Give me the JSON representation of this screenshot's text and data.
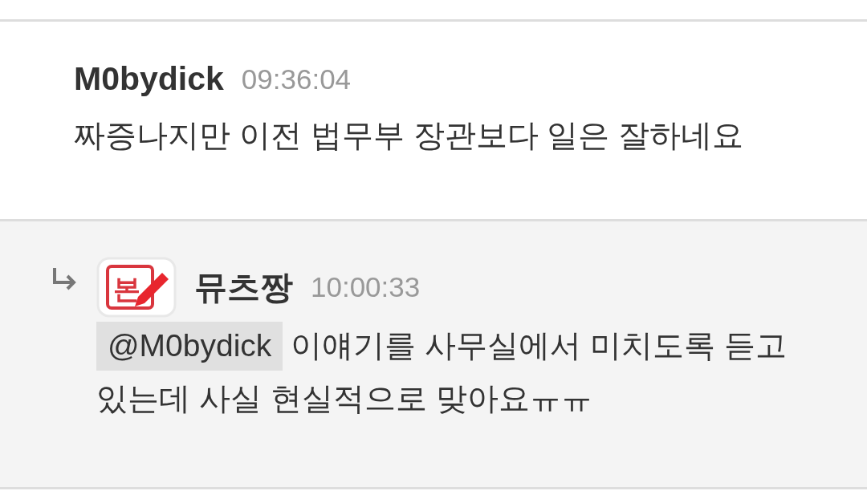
{
  "comments": [
    {
      "kind": "comment",
      "author": "M0bydick",
      "time": "09:36:04",
      "body": "짜증나지만 이전 법무부 장관보다 일은 잘하네요"
    },
    {
      "kind": "reply",
      "author": "뮤츠짱",
      "badge": "본",
      "time": "10:00:33",
      "mention": "@M0bydick",
      "body": "이얘기를 사무실에서 미치도록 듣고 있는데 사실 현실적으로 맞아요ㅠㅠ"
    }
  ]
}
